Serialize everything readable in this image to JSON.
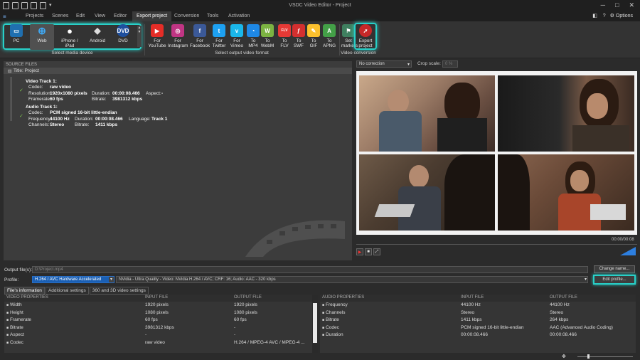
{
  "window": {
    "title": "VSDC Video Editor - Project",
    "options_label": "Options"
  },
  "menu": [
    "Projects",
    "Scenes",
    "Edit",
    "View",
    "Editor",
    "Export project",
    "Conversion",
    "Tools",
    "Activation"
  ],
  "ribbon": {
    "devices": [
      {
        "label": "PC",
        "icon": "monitor-icon"
      },
      {
        "label": "Web",
        "icon": "globe-icon"
      },
      {
        "label": "iPhone / iPad",
        "icon": "apple-icon"
      },
      {
        "label": "Android",
        "icon": "android-icon"
      },
      {
        "label": "DVD",
        "icon": "dvd-icon"
      }
    ],
    "devices_group": "Select media device",
    "formats": [
      {
        "l1": "For",
        "l2": "YouTube",
        "icon": "youtube-icon",
        "color": "#e52d27",
        "glyph": "▶"
      },
      {
        "l1": "For",
        "l2": "Instagram",
        "icon": "instagram-icon",
        "color": "#c13584",
        "glyph": "◎"
      },
      {
        "l1": "For",
        "l2": "Facebook",
        "icon": "facebook-icon",
        "color": "#3b5998",
        "glyph": "f"
      },
      {
        "l1": "For",
        "l2": "Twitter",
        "icon": "twitter-icon",
        "color": "#1da1f2",
        "glyph": "t"
      },
      {
        "l1": "For",
        "l2": "Vimeo",
        "icon": "vimeo-icon",
        "color": "#1ab7ea",
        "glyph": "v"
      },
      {
        "l1": "To",
        "l2": "MP4",
        "icon": "mp4-icon",
        "color": "#1e88e5",
        "glyph": "◔"
      },
      {
        "l1": "To",
        "l2": "WebM",
        "icon": "webm-icon",
        "color": "#7cb342",
        "glyph": "W"
      },
      {
        "l1": "To",
        "l2": "FLV",
        "icon": "flv-icon",
        "color": "#e53935",
        "glyph": "FLV"
      },
      {
        "l1": "To",
        "l2": "SWF",
        "icon": "swf-icon",
        "color": "#d32f2f",
        "glyph": "ƒ"
      },
      {
        "l1": "To",
        "l2": "GIF",
        "icon": "gif-icon",
        "color": "#fbc02d",
        "glyph": "✎"
      },
      {
        "l1": "To",
        "l2": "APNG",
        "icon": "apng-icon",
        "color": "#43a047",
        "glyph": "A"
      }
    ],
    "formats_group": "Select output video format",
    "set_markers": {
      "l1": "Set",
      "l2": "markers"
    },
    "export_project": {
      "l1": "Export",
      "l2": "project"
    },
    "conversion_group": "Video conversion"
  },
  "source": {
    "header": "SOURCE FILES",
    "title": "Title: Project",
    "video": {
      "name": "Video Track 1:",
      "codec_label": "Codec:",
      "codec": "raw video",
      "res_label": "Resolution:",
      "res": "1920x1080 pixels",
      "dur_label": "Duration:",
      "dur": "00:00:08.466",
      "aspect_label": "Aspect:",
      "aspect": "-",
      "fr_label": "Framerate:",
      "fr": "60 fps",
      "br_label": "Bitrate:",
      "br": "3981312 kbps"
    },
    "audio": {
      "name": "Audio Track 1:",
      "codec_label": "Codec:",
      "codec": "PCM signed 16-bit little-endian",
      "freq_label": "Frequency:",
      "freq": "44100 Hz",
      "dur_label": "Duration:",
      "dur": "00:00:08.466",
      "lang_label": "Language:",
      "lang": "Track 1",
      "ch_label": "Channels:",
      "ch": "Stereo",
      "br_label": "Bitrate:",
      "br": "1411 kbps"
    }
  },
  "preview": {
    "correction": "No correction",
    "crop_label": "Crop scale:",
    "crop_value": "0 %",
    "timecode": "00:00/00:08"
  },
  "output": {
    "file_label": "Output file(s):",
    "file_value": "D:\\Project.mp4",
    "change_name": "Change name...",
    "profile_label": "Profile:",
    "profile_value": "H.264 / AVC Hardware Accelerated",
    "profile_desc": "NVidia - Ultra Quality - Video: NVidia H.264 / AVC; CRF: 16; Audio: AAC - 320 kbps",
    "edit_profile": "Edit profile..."
  },
  "tabs": [
    "File's information",
    "Additional settings",
    "360 and 3D video settings"
  ],
  "video_props": {
    "headers": [
      "VIDEO PROPERTIES",
      "INPUT FILE",
      "OUTPUT FILE"
    ],
    "rows": [
      [
        "Width",
        "1920 pixels",
        "1920 pixels"
      ],
      [
        "Height",
        "1080 pixels",
        "1080 pixels"
      ],
      [
        "Framerate",
        "60 fps",
        "60 fps"
      ],
      [
        "Bitrate",
        "3981312 kbps",
        "-"
      ],
      [
        "Aspect",
        "-",
        "-"
      ],
      [
        "Codec",
        "raw video",
        "H.264 / MPEG-4 AVC / MPEG-4 ..."
      ]
    ]
  },
  "audio_props": {
    "headers": [
      "AUDIO PROPERTIES",
      "INPUT FILE",
      "OUTPUT FILE"
    ],
    "rows": [
      [
        "Frequency",
        "44100 Hz",
        "44100 Hz"
      ],
      [
        "Channels",
        "Stereo",
        "Stereo"
      ],
      [
        "Bitrate",
        "1411 kbps",
        "264 kbps"
      ],
      [
        "Codec",
        "PCM signed 16-bit little-endian",
        "AAC (Advanced Audio Coding)"
      ],
      [
        "Duration",
        "00:00:08.466",
        "00:00:08.466"
      ]
    ]
  },
  "colors": {
    "accent_glow": "#28d0c8",
    "profile_highlight": "#1a5fb4"
  }
}
